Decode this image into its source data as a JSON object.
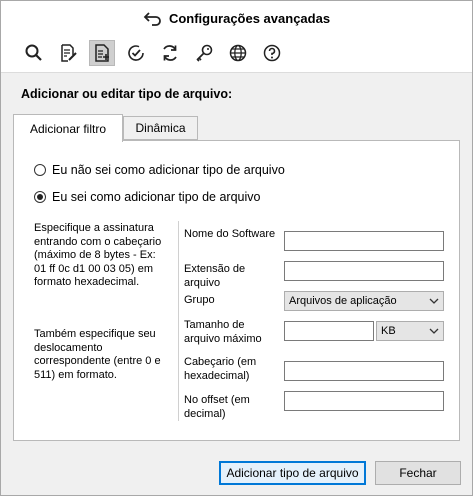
{
  "window": {
    "title": "Configurações avançadas"
  },
  "toolbar": {
    "items": [
      {
        "icon": "search-icon"
      },
      {
        "icon": "edit-document-icon"
      },
      {
        "icon": "add-file-type-icon",
        "active": true
      },
      {
        "icon": "check-circle-icon"
      },
      {
        "icon": "refresh-icon"
      },
      {
        "icon": "key-icon"
      },
      {
        "icon": "globe-icon"
      },
      {
        "icon": "help-icon"
      }
    ]
  },
  "main": {
    "heading": "Adicionar ou editar tipo de arquivo:",
    "tabs": [
      {
        "label": "Adicionar filtro",
        "selected": true
      },
      {
        "label": "Dinâmica",
        "selected": false
      }
    ],
    "options": [
      {
        "label": "Eu não sei como adicionar tipo de arquivo",
        "checked": false
      },
      {
        "label": "Eu sei como adicionar tipo de arquivo",
        "checked": true
      }
    ],
    "help_text_1": "Especifique a assinatura entrando com o cabeçario (máximo de 8 bytes - Ex: 01 ff 0c d1 00 03 05) em formato hexadecimal.",
    "help_text_2": " Também especifique seu deslocamento correspondente (entre 0 e 511) em formato.",
    "fields": {
      "software_name_label": "Nome do Software",
      "software_name_value": "",
      "extension_label": "Extensão de arquivo",
      "extension_value": "",
      "group_label": "Grupo",
      "group_value": "Arquivos de aplicação",
      "max_size_label": "Tamanho de arquivo máximo",
      "max_size_value": "",
      "max_size_unit": "KB",
      "header_label": "Cabeçario (em hexadecimal)",
      "header_value": "",
      "offset_label": "No offset (em decimal)",
      "offset_value": ""
    }
  },
  "footer": {
    "add_label": "Adicionar tipo de arquivo",
    "close_label": "Fechar"
  }
}
